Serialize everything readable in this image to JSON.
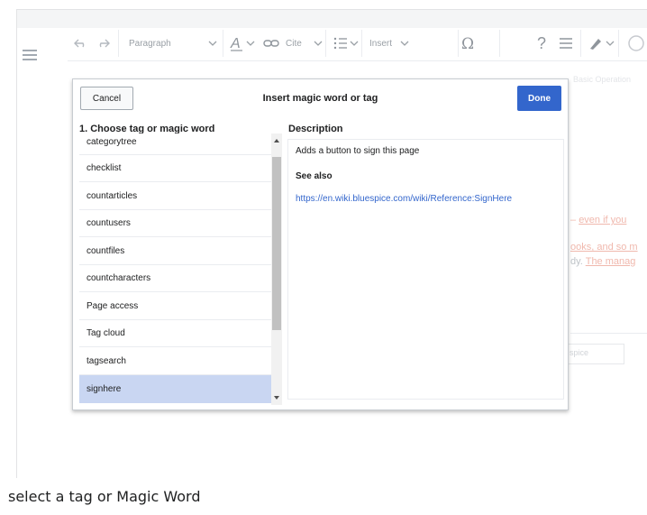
{
  "toolbar": {
    "paragraph_label": "Paragraph",
    "cite_label": "Cite",
    "insert_label": "Insert",
    "help_glyph": "?"
  },
  "background": {
    "faint_header": "Basic Operation",
    "line_1_link": "even if you",
    "line_2_link": "ooks, and so m",
    "line_3_text": "dy.",
    "line_3_link": "The manag",
    "box_text": "spice"
  },
  "dialog": {
    "title": "Insert magic word or tag",
    "cancel_label": "Cancel",
    "done_label": "Done",
    "list_heading": "1. Choose tag or magic word",
    "description_heading": "Description",
    "items": [
      {
        "label": "categorytree"
      },
      {
        "label": "checklist"
      },
      {
        "label": "countarticles"
      },
      {
        "label": "countusers"
      },
      {
        "label": "countfiles"
      },
      {
        "label": "countcharacters"
      },
      {
        "label": "Page access"
      },
      {
        "label": "Tag cloud"
      },
      {
        "label": "tagsearch"
      },
      {
        "label": "signhere"
      }
    ],
    "selected_index": 9,
    "description": {
      "text": "Adds a button to sign this page",
      "see_also_label": "See also",
      "link": "https://en.wiki.bluespice.com/wiki/Reference:SignHere"
    }
  },
  "caption": "select a tag or Magic Word",
  "colors": {
    "accent": "#3366cc",
    "selected_row": "#c9d6f2"
  }
}
